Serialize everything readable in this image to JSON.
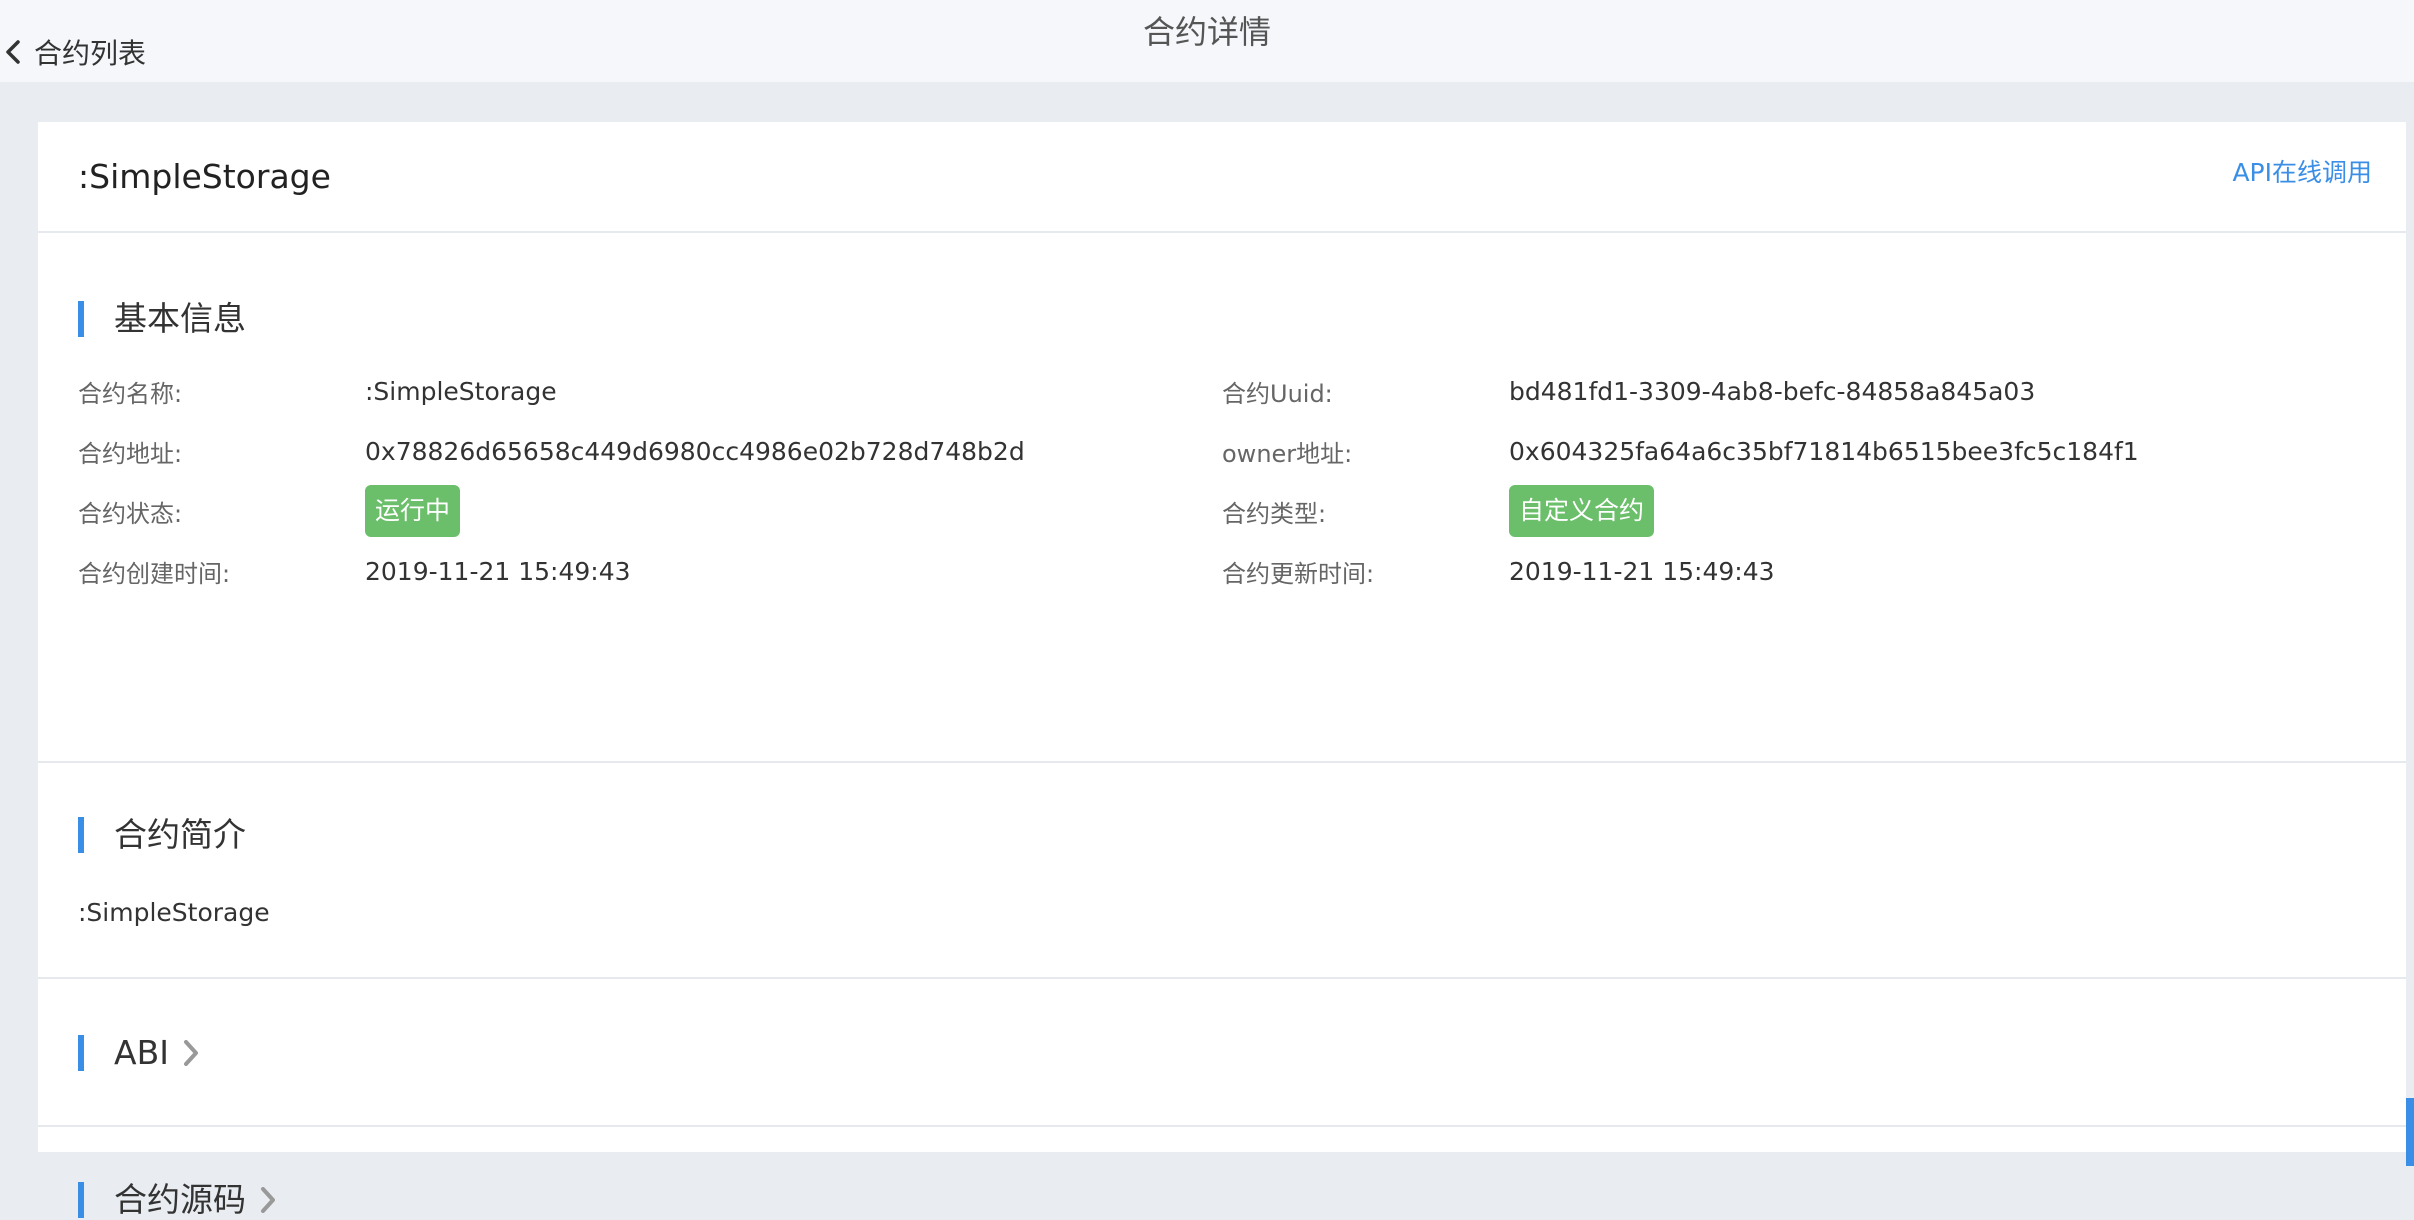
{
  "topbar": {
    "back_label": "合约列表",
    "page_title": "合约详情"
  },
  "card": {
    "title": ":SimpleStorage",
    "api_link": "API在线调用"
  },
  "basic_info": {
    "title": "基本信息",
    "left": [
      {
        "label": "合约名称:",
        "value": ":SimpleStorage"
      },
      {
        "label": "合约地址:",
        "value": "0x78826d65658c449d6980cc4986e02b728d748b2d"
      },
      {
        "label": "合约状态:",
        "value": "运行中"
      },
      {
        "label": "合约创建时间:",
        "value": "2019-11-21 15:49:43"
      }
    ],
    "right": [
      {
        "label": "合约Uuid:",
        "value": "bd481fd1-3309-4ab8-befc-84858a845a03"
      },
      {
        "label": "owner地址:",
        "value": "0x604325fa64a6c35bf71814b6515bee3fc5c184f1"
      },
      {
        "label": "合约类型:",
        "value": "自定义合约"
      },
      {
        "label": "合约更新时间:",
        "value": "2019-11-21 15:49:43"
      }
    ]
  },
  "description": {
    "title": "合约简介",
    "text": ":SimpleStorage"
  },
  "abi": {
    "title": "ABI"
  },
  "source": {
    "title": "合约源码"
  },
  "colors": {
    "accent": "#3a8ee6",
    "tag_green": "#6bbf6a",
    "background": "#e9edf1"
  }
}
